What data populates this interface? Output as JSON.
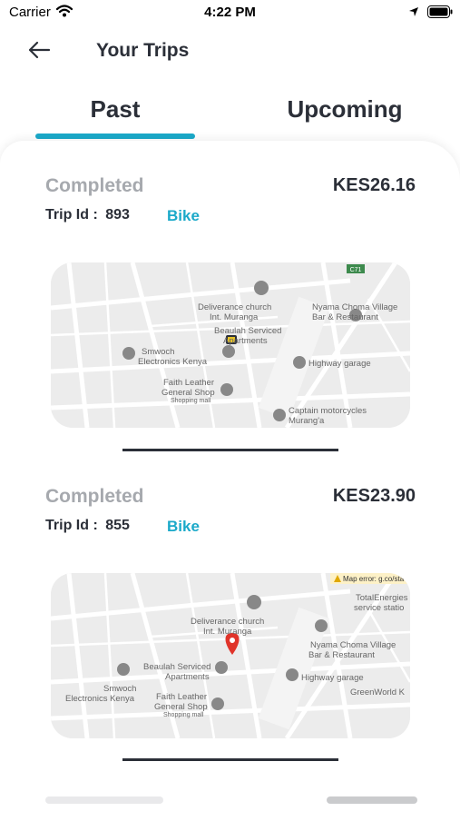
{
  "status_bar": {
    "carrier": "Carrier",
    "time": "4:22 PM"
  },
  "header": {
    "title": "Your Trips"
  },
  "tabs": [
    {
      "label": "Past",
      "active": true
    },
    {
      "label": "Upcoming",
      "active": false
    }
  ],
  "accent_color": "#1ba9c9",
  "trips": [
    {
      "status": "Completed",
      "price": "KES26.16",
      "trip_id_label": "Trip Id :",
      "trip_id": "893",
      "vehicle": "Bike",
      "map_labels": {
        "road": "C71",
        "church1": "Deliverance church",
        "church2": "Int. Muranga",
        "apt1": "Beaulah Serviced",
        "apt2": "Apartments",
        "smw1": "Smwoch",
        "smw2": "Electronics Kenya",
        "nyama1": "Nyama Choma Village",
        "nyama2": "Bar & Restaurant",
        "garage": "Highway garage",
        "faith1": "Faith Leather",
        "faith2": "General Shop",
        "mall": "Shopping mall",
        "captain1": "Captain motorcycles",
        "captain2": "Murang'a"
      }
    },
    {
      "status": "Completed",
      "price": "KES23.90",
      "trip_id_label": "Trip Id :",
      "trip_id": "855",
      "vehicle": "Bike",
      "map_labels": {
        "error": "Map error: g.co/sta",
        "total1": "TotalEnergies",
        "total2": "service statio",
        "church1": "Deliverance church",
        "church2": "Int. Muranga",
        "apt1": "Beaulah Serviced",
        "apt2": "Apartments",
        "smw1": "Smwoch",
        "smw2": "Electronics Kenya",
        "nyama1": "Nyama Choma Village",
        "nyama2": "Bar & Restaurant",
        "garage": "Highway garage",
        "faith1": "Faith Leather",
        "faith2": "General Shop",
        "mall": "Shopping mall",
        "greenworld": "GreenWorld K"
      }
    }
  ]
}
